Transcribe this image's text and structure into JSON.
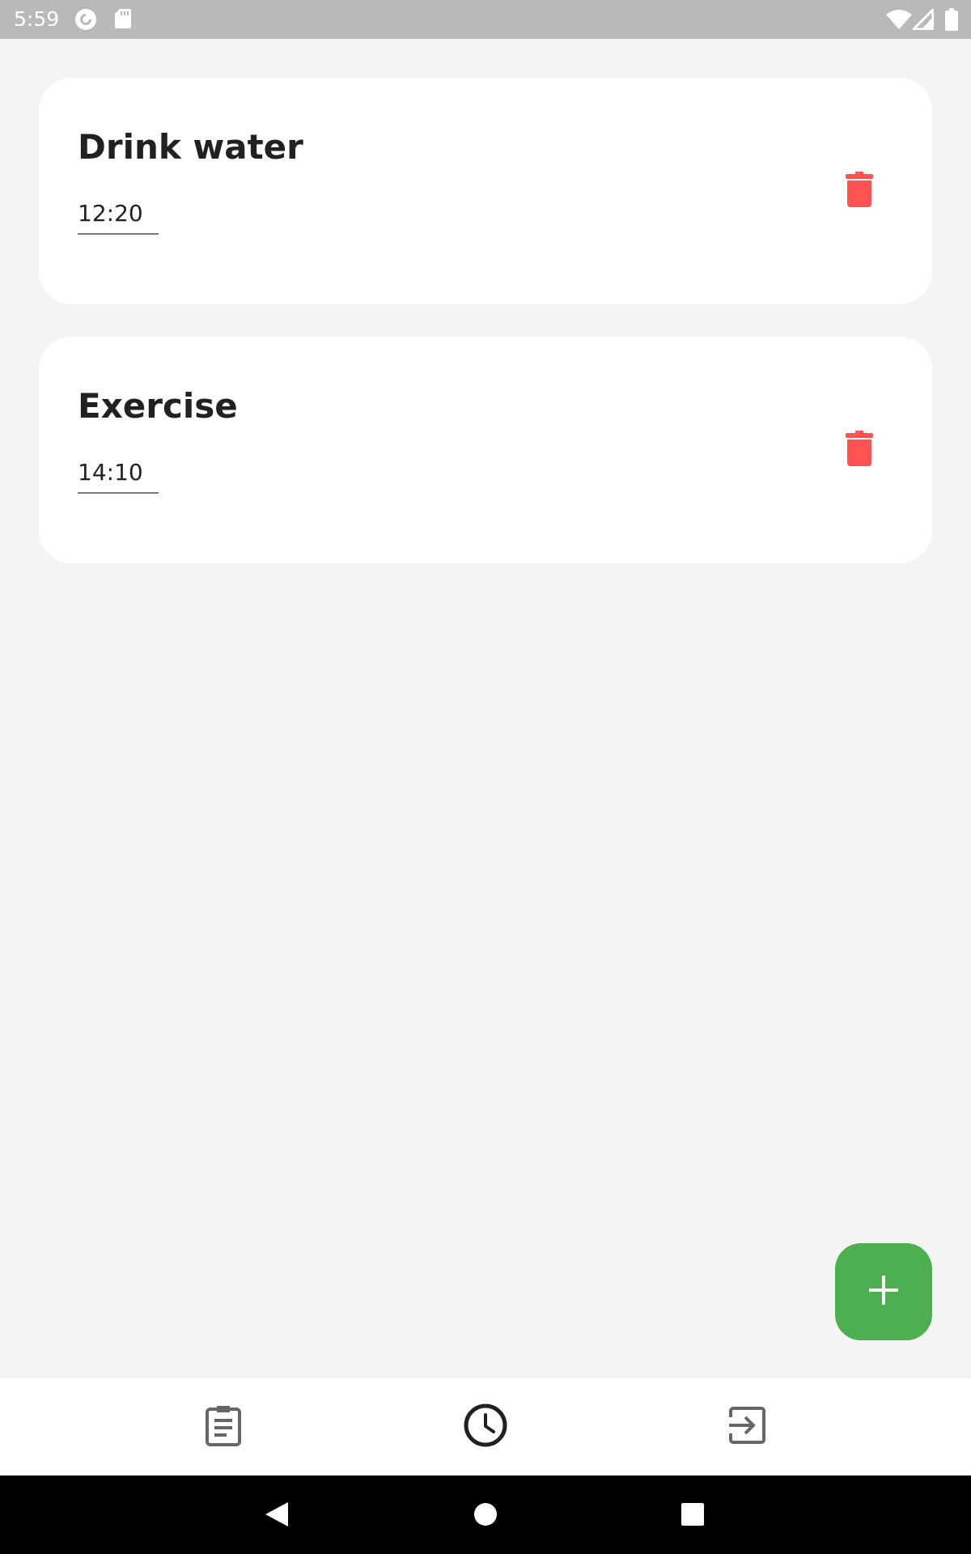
{
  "status_bar": {
    "time": "5:59",
    "icons": [
      "pocket-casts-icon",
      "sd-card-icon",
      "wifi-icon",
      "cell-signal-icon",
      "battery-icon"
    ]
  },
  "reminders": [
    {
      "title": "Drink water",
      "time": "12:20"
    },
    {
      "title": "Exercise",
      "time": "14:10"
    }
  ],
  "fab": {
    "icon": "plus-icon",
    "color": "#4caf50"
  },
  "bottom_nav": {
    "items": [
      {
        "icon": "clipboard-icon",
        "selected": false
      },
      {
        "icon": "clock-icon",
        "selected": true
      },
      {
        "icon": "logout-icon",
        "selected": false
      }
    ]
  },
  "colors": {
    "delete": "#ff5252",
    "background": "#f4f4f4",
    "card": "#ffffff",
    "status_bar": "#b9b9b9"
  },
  "system_nav": {
    "buttons": [
      "back-icon",
      "home-icon",
      "recents-icon"
    ]
  }
}
